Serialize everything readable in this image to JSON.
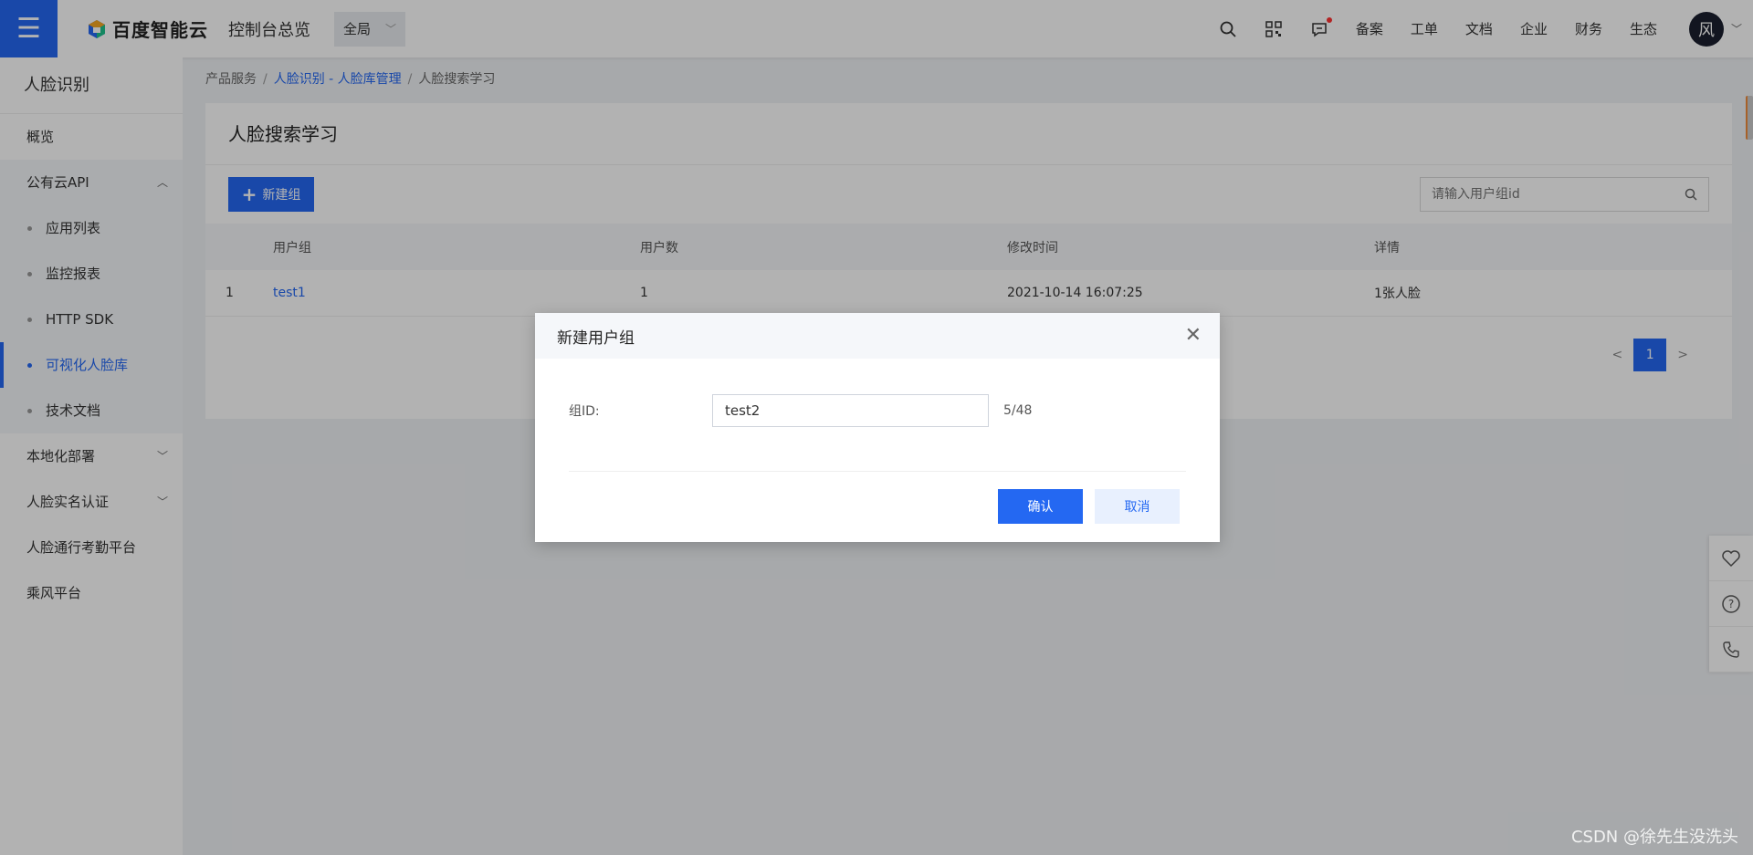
{
  "header": {
    "brand": "百度智能云",
    "console_title": "控制台总览",
    "region": "全局",
    "links": [
      "备案",
      "工单",
      "文档",
      "企业",
      "财务",
      "生态"
    ],
    "avatar_text": "风"
  },
  "sidebar": {
    "title": "人脸识别",
    "items": [
      {
        "label": "概览"
      },
      {
        "label": "公有云API"
      },
      {
        "label": "应用列表"
      },
      {
        "label": "监控报表"
      },
      {
        "label": "HTTP SDK"
      },
      {
        "label": "可视化人脸库"
      },
      {
        "label": "技术文档"
      },
      {
        "label": "本地化部署"
      },
      {
        "label": "人脸实名认证"
      },
      {
        "label": "人脸通行考勤平台"
      },
      {
        "label": "乘风平台"
      }
    ]
  },
  "breadcrumb": [
    "产品服务",
    "人脸识别 - 人脸库管理",
    "人脸搜索学习"
  ],
  "page": {
    "title": "人脸搜索学习",
    "new_button": "新建组",
    "search_placeholder": "请输入用户组id"
  },
  "table": {
    "columns": [
      "",
      "用户组",
      "用户数",
      "修改时间",
      "详情"
    ],
    "rows": [
      {
        "index": "1",
        "group": "test1",
        "users": "1",
        "modified": "2021-10-14 16:07:25",
        "detail": "1张人脸"
      }
    ]
  },
  "pager": {
    "prev": "<",
    "current": "1",
    "next": ">"
  },
  "modal": {
    "title": "新建用户组",
    "label": "组ID:",
    "value": "test2",
    "count": "5/48",
    "ok": "确认",
    "cancel": "取消"
  },
  "watermark": "CSDN @徐先生没洗头",
  "colors": {
    "primary": "#2468f2",
    "sidebar_active": "#2468f2"
  }
}
